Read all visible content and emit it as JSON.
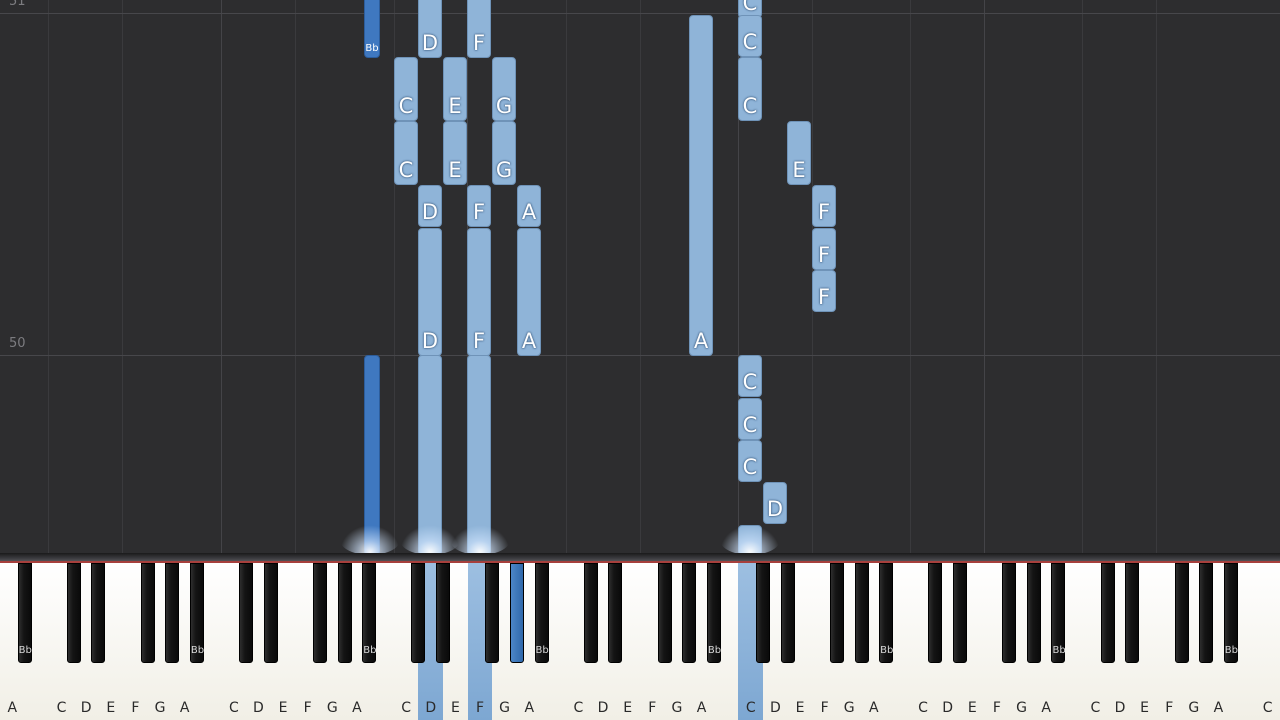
{
  "roll": {
    "measures": [
      {
        "number": "51",
        "key": "m51"
      },
      {
        "number": "50",
        "key": "m50"
      }
    ],
    "notes": [
      {
        "label": "Bb",
        "kind": "bb"
      },
      {
        "label": "D"
      },
      {
        "label": "F"
      },
      {
        "label": "C"
      },
      {
        "label": "E"
      },
      {
        "label": "G"
      },
      {
        "label": "C"
      },
      {
        "label": "E"
      },
      {
        "label": "G"
      },
      {
        "label": "D"
      },
      {
        "label": "F"
      },
      {
        "label": "A"
      },
      {
        "label": "D"
      },
      {
        "label": "F"
      },
      {
        "label": "A"
      },
      {
        "label": "A"
      },
      {
        "label": "C"
      },
      {
        "label": "C"
      },
      {
        "label": "C"
      },
      {
        "label": "E"
      },
      {
        "label": "F"
      },
      {
        "label": "F"
      },
      {
        "label": "F"
      },
      {
        "label": "",
        "kind": "bb"
      },
      {
        "label": ""
      },
      {
        "label": ""
      },
      {
        "label": "C"
      },
      {
        "label": "C"
      },
      {
        "label": "C"
      },
      {
        "label": "D"
      },
      {
        "label": ""
      }
    ]
  },
  "keyboard": {
    "white_keys": [
      "A",
      "",
      "C",
      "D",
      "E",
      "F",
      "G",
      "A",
      "",
      "C",
      "D",
      "E",
      "F",
      "G",
      "A",
      "",
      "C",
      "D",
      "E",
      "F",
      "G",
      "A",
      "",
      "C",
      "D",
      "E",
      "F",
      "G",
      "A",
      "",
      "C",
      "D",
      "E",
      "F",
      "G",
      "A",
      "",
      "C",
      "D",
      "E",
      "F",
      "G",
      "A",
      "",
      "C",
      "D",
      "E",
      "F",
      "G",
      "A",
      "",
      "C"
    ],
    "black_key_label": "Bb",
    "active_white": [
      17,
      19,
      30
    ],
    "active_black": [
      14
    ]
  },
  "colors": {
    "note": "#8fb4d8",
    "note_bb": "#3f78c0",
    "background": "#2d2d2f"
  }
}
